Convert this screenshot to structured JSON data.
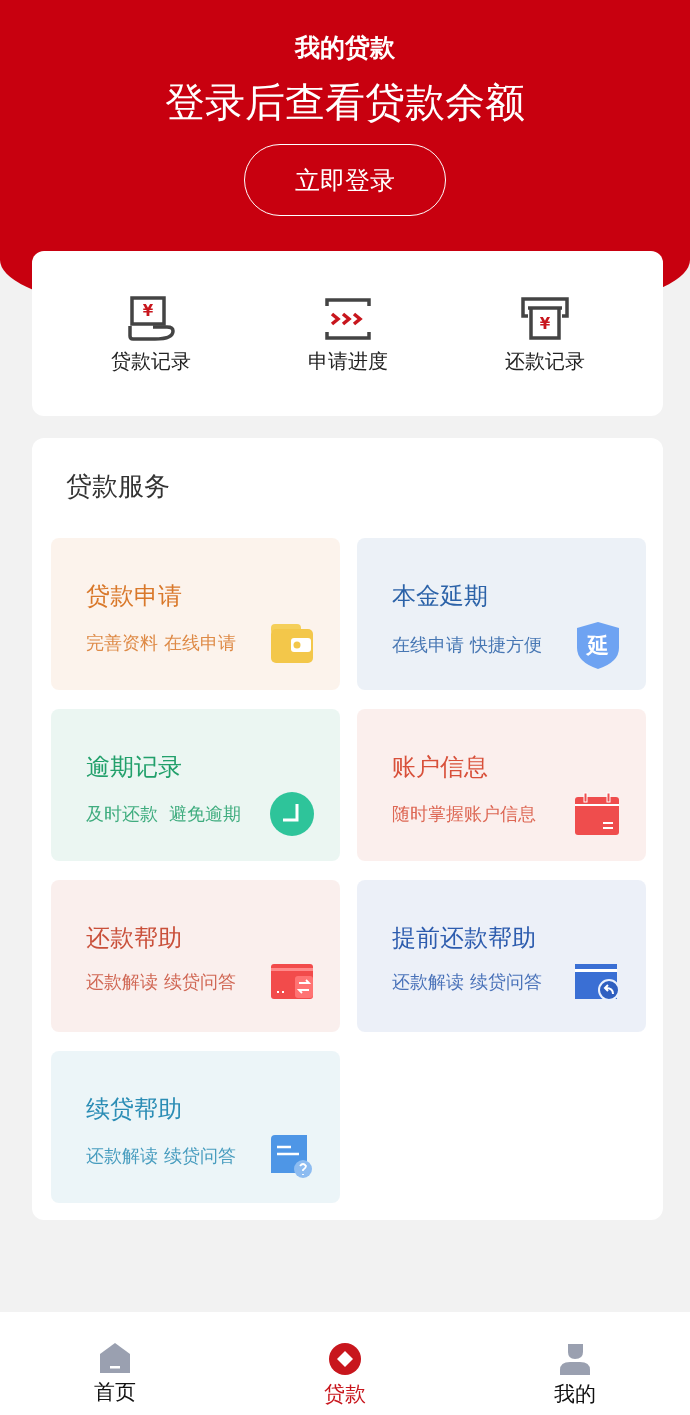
{
  "header": {
    "title": "我的贷款",
    "headline": "登录后查看贷款余额",
    "login_button": "立即登录"
  },
  "quick_links": [
    {
      "kind": "loan",
      "label": "贷款记录",
      "icon_text": "¥"
    },
    {
      "kind": "progress",
      "label": "申请进度"
    },
    {
      "kind": "repay",
      "label": "还款记录",
      "icon_text": "¥"
    }
  ],
  "services": {
    "title": "贷款服务",
    "tiles": [
      {
        "kind": "wallet",
        "title": "贷款申请",
        "subtitle": "完善资料 在线申请",
        "color": "#d9782a"
      },
      {
        "kind": "shield",
        "title": "本金延期",
        "subtitle": "在线申请 快捷方便",
        "color": "#2b62a8",
        "icon_text": "延"
      },
      {
        "kind": "clock",
        "title": "逾期记录",
        "subtitle": "及时还款  避免逾期",
        "color": "#22a06b"
      },
      {
        "kind": "calendar",
        "title": "账户信息",
        "subtitle": "随时掌握账户信息",
        "color": "#d8503a"
      },
      {
        "kind": "card",
        "title": "还款帮助",
        "subtitle": "还款解读 续贷问答",
        "color": "#c9503a"
      },
      {
        "kind": "card-return",
        "title": "提前还款帮助",
        "subtitle": "还款解读 续贷问答",
        "color": "#2d5cae"
      },
      {
        "kind": "doc-question",
        "title": "续贷帮助",
        "subtitle": "还款解读 续贷问答",
        "color": "#2b8db5"
      }
    ]
  },
  "tab_bar": [
    {
      "kind": "home",
      "label": "首页",
      "selected": false
    },
    {
      "kind": "loan",
      "label": "贷款",
      "selected": true
    },
    {
      "kind": "me",
      "label": "我的",
      "selected": false
    }
  ]
}
